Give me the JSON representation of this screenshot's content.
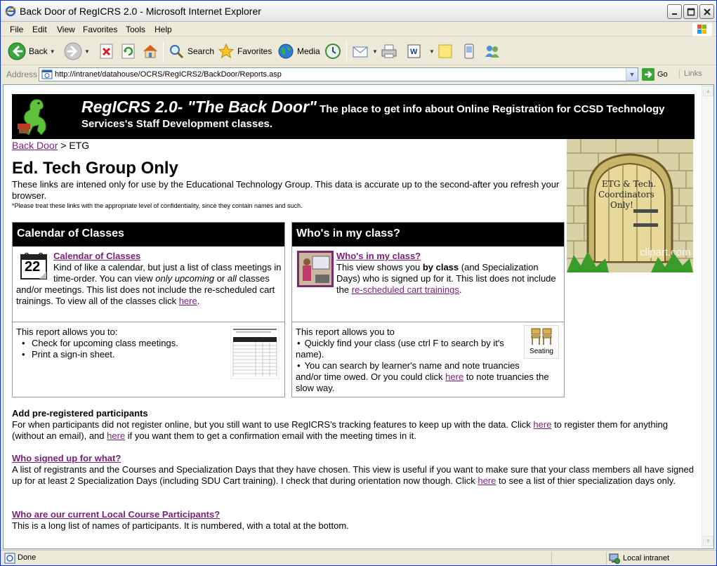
{
  "window": {
    "title": "Back Door of RegICRS 2.0 - Microsoft Internet Explorer"
  },
  "menu": [
    "File",
    "Edit",
    "View",
    "Favorites",
    "Tools",
    "Help"
  ],
  "toolbar": {
    "back": "Back",
    "search": "Search",
    "favorites": "Favorites",
    "media": "Media"
  },
  "address": {
    "label": "Address",
    "url": "http://intranet/datahouse/OCRS/RegICRS2/BackDoor/Reports.asp",
    "go": "Go",
    "links": "Links"
  },
  "banner": {
    "big_title": "RegICRS 2.0- \"The Back Door\"",
    "subtitle": " The place to get info about Online Registration for CCSD Technology Services's Staff Development classes."
  },
  "breadcrumb": {
    "link": "Back Door",
    "sep": " > ",
    "current": "ETG"
  },
  "clipart": {
    "sign_text": [
      "ETG & Tech.",
      "Coordinators",
      "Only!"
    ],
    "watermark": "clipart.com"
  },
  "page": {
    "title": "Ed. Tech Group Only",
    "intro": "These links are intened only for use by the Educational Technology Group. This data is accurate up to the second-after you refresh your browser.",
    "note": "*Please treat these links with the appropriate level of confidentiality, since they contain names and such."
  },
  "calendar_panel": {
    "heading": "Calendar of Classes",
    "icon_day": "22",
    "link": "Calendar of Classes",
    "desc_1": "Kind of like a calendar, but just a list of class meetings in time-order. You can view ",
    "desc_em1": "only upcoming",
    "desc_2": " or ",
    "desc_em2": "all",
    "desc_3": " classes and/or meetings. This list does not include the re-scheduled cart trainings. To view all of the classes click ",
    "desc_link": "here",
    "desc_4": ".",
    "report_intro": "This report allows you to:",
    "bullets": [
      "Check for upcoming class meetings.",
      "Print a sign-in sheet."
    ]
  },
  "class_panel": {
    "heading": "Who's in my class?",
    "link": "Who's in my class?",
    "desc_1": "This view shows you ",
    "desc_bold": "by class",
    "desc_2": " (and Specialization Days) who is signed up for it. This list does not include the ",
    "desc_link": "re-scheduled cart trainings",
    "desc_3": ".",
    "report_intro": "This report allows you to",
    "bullet_1": "Quickly find your class (use ctrl F to search by it's name).",
    "bullet_2a": "You can search by learner's name and note truancies and/or time owed. Or you could click ",
    "bullet_2_link": "here",
    "bullet_2b": " to note truancies the slow way.",
    "seating_label": "Seating"
  },
  "preregistered": {
    "heading": "Add pre-registered participants",
    "text_1": "For when participants did not register online, but you still want to use RegICRS's tracking features to keep up with the data. Click ",
    "link_1": "here",
    "text_2": " to register them for anything (without an email), and ",
    "link_2": "here",
    "text_3": " if you want them to get a confirmation email with the meeting times in it."
  },
  "signed_up": {
    "heading_link": "Who signed up for what?",
    "text_1": "A list of registrants and the Courses and Specialization Days that they have chosen. This view is useful if you want to make sure that your class members all have signed up for at least 2 Specialization Days (including SDU Cart training). I check that during orientation now though. Click ",
    "link": "here",
    "text_2": " to see a list of thier specialization days only."
  },
  "participants": {
    "heading_link": "Who are our current Local Course Participants?",
    "text": "This is a long list of names of participants. It is numbered, with a total at the bottom."
  },
  "status": {
    "text": "Done",
    "zone": "Local intranet"
  }
}
